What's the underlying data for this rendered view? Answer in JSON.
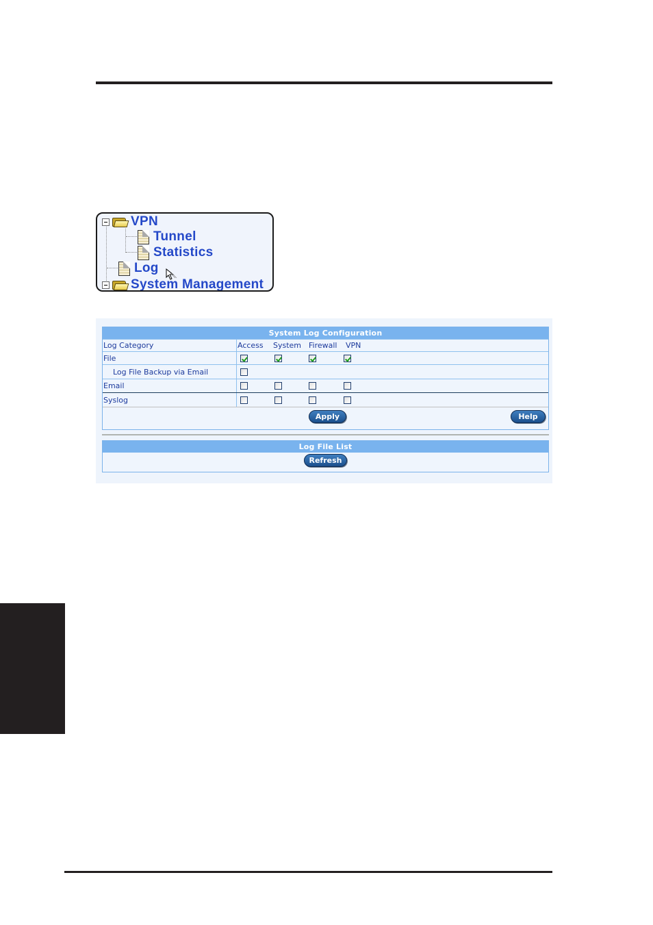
{
  "page": {
    "colors": {
      "rule": "#231f20",
      "panel_header": "#79b3ee",
      "label_text": "#1c3a9c",
      "tree_text": "#2448c8",
      "check": "#1c9c1c",
      "button": "#1b4f8c"
    }
  },
  "tree": {
    "items": [
      {
        "label": "VPN",
        "type": "folder",
        "expanded": true,
        "icon": "folder-open-icon"
      },
      {
        "label": "Tunnel",
        "type": "page",
        "icon": "document-icon"
      },
      {
        "label": "Statistics",
        "type": "page",
        "icon": "document-icon"
      },
      {
        "label": "Log",
        "type": "page",
        "icon": "document-icon",
        "hovered": true
      },
      {
        "label": "System Management",
        "type": "folder",
        "expanded": true,
        "icon": "folder-open-icon"
      }
    ]
  },
  "config": {
    "title": "System Log Configuration",
    "header_row": {
      "label": "Log Category",
      "columns": [
        "Access",
        "System",
        "Firewall",
        "VPN"
      ]
    },
    "rows": [
      {
        "label": "File",
        "checks": [
          true,
          true,
          true,
          true
        ]
      },
      {
        "label": "Log File Backup via Email",
        "checks": [
          false
        ]
      },
      {
        "label": "Email",
        "checks": [
          false,
          false,
          false,
          false
        ]
      },
      {
        "label": "Syslog",
        "checks": [
          false,
          false,
          false,
          false
        ]
      }
    ],
    "apply_label": "Apply",
    "help_label": "Help"
  },
  "log_list": {
    "title": "Log File List",
    "refresh_label": "Refresh"
  }
}
